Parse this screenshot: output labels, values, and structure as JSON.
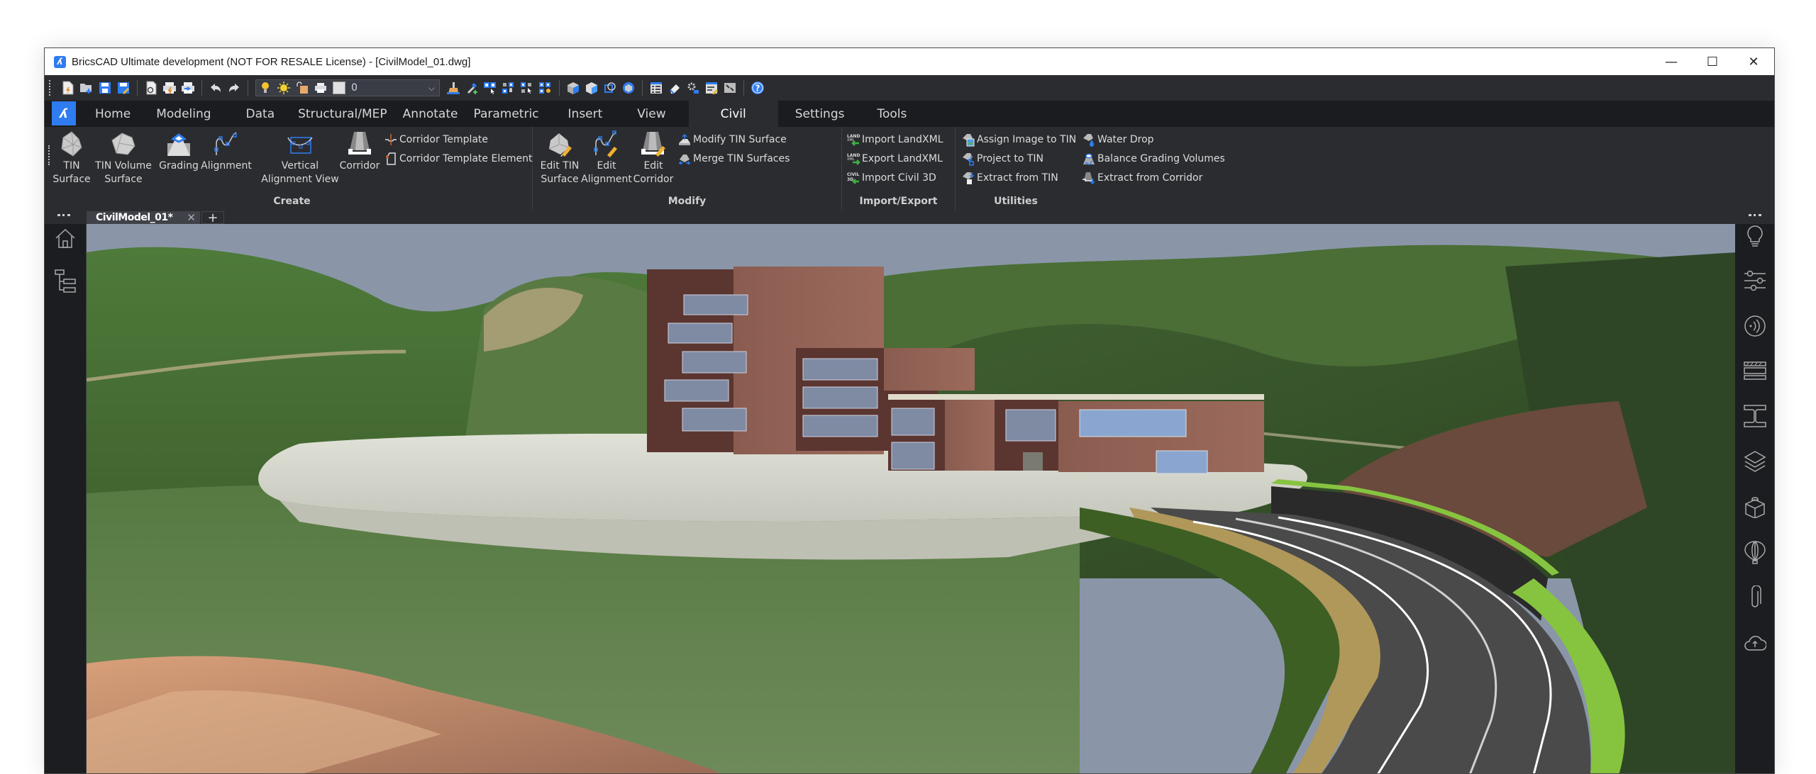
{
  "window": {
    "title": "BricsCAD Ultimate development (NOT FOR RESALE License) - [CivilModel_01.dwg]",
    "controls": {
      "minimize": "—",
      "maximize": "☐",
      "close": "✕"
    }
  },
  "quick_access": {
    "icons": [
      "new-icon",
      "open-icon",
      "save-icon",
      "save-as-icon",
      "print-preview-icon",
      "plot-icon",
      "batch-plot-icon",
      "undo-icon",
      "redo-icon",
      "layer-on-icon",
      "layer-freeze-icon",
      "layer-lock-icon",
      "layer-plot-icon"
    ],
    "layer_value": "0",
    "tool_icons": [
      "match-properties-icon",
      "pick-add-icon",
      "select-icon",
      "isolate-icon",
      "select-similar-icon",
      "hide-icon",
      "solid-box-icon",
      "solid-blue-icon",
      "region-icon",
      "view-cube-icon",
      "properties-icon",
      "eraser-icon",
      "settings-icon",
      "edit-icon",
      "window-icon",
      "help-icon"
    ]
  },
  "ribbon": {
    "tabs": [
      "Home",
      "Modeling",
      "Data",
      "Structural/MEP",
      "Annotate",
      "Parametric",
      "Insert",
      "View",
      "Civil",
      "Settings",
      "Tools"
    ],
    "active_tab": "Civil",
    "panels": {
      "create": {
        "title": "Create",
        "big_buttons": [
          {
            "label1": "TIN",
            "label2": "Surface",
            "icon": "tin-surface-icon"
          },
          {
            "label1": "TIN Volume",
            "label2": "Surface",
            "icon": "tin-volume-surface-icon"
          },
          {
            "label1": "Grading",
            "label2": "",
            "icon": "grading-icon"
          },
          {
            "label1": "Alignment",
            "label2": "",
            "icon": "alignment-icon"
          },
          {
            "label1": "Vertical",
            "label2": "Alignment View",
            "icon": "vertical-alignment-view-icon"
          },
          {
            "label1": "Corridor",
            "label2": "",
            "icon": "corridor-icon"
          }
        ],
        "small_buttons": [
          {
            "label": "Corridor Template",
            "icon": "corridor-template-icon"
          },
          {
            "label": "Corridor Template Element",
            "icon": "corridor-template-element-icon"
          }
        ]
      },
      "modify": {
        "title": "Modify",
        "big_buttons": [
          {
            "label1": "Edit TIN",
            "label2": "Surface",
            "icon": "edit-tin-surface-icon"
          },
          {
            "label1": "Edit",
            "label2": "Alignment",
            "icon": "edit-alignment-icon"
          },
          {
            "label1": "Edit",
            "label2": "Corridor",
            "icon": "edit-corridor-icon"
          }
        ],
        "small_buttons": [
          {
            "label": "Modify TIN Surface",
            "icon": "modify-tin-surface-icon"
          },
          {
            "label": "Merge TIN Surfaces",
            "icon": "merge-tin-surfaces-icon"
          }
        ]
      },
      "import_export": {
        "title": "Import/Export",
        "small_buttons": [
          {
            "label": "Import LandXML",
            "icon": "import-landxml-icon"
          },
          {
            "label": "Export LandXML",
            "icon": "export-landxml-icon"
          },
          {
            "label": "Import Civil 3D",
            "icon": "import-civil3d-icon"
          }
        ]
      },
      "utilities": {
        "title": "Utilities",
        "small_buttons": [
          {
            "label": "Assign Image to TIN",
            "icon": "assign-image-icon"
          },
          {
            "label": "Project to TIN",
            "icon": "project-to-tin-icon"
          },
          {
            "label": "Extract from TIN",
            "icon": "extract-from-tin-icon"
          },
          {
            "label": "Water Drop",
            "icon": "water-drop-icon"
          },
          {
            "label": "Balance Grading Volumes",
            "icon": "balance-grading-icon"
          },
          {
            "label": "Extract from Corridor",
            "icon": "extract-from-corridor-icon"
          }
        ]
      }
    }
  },
  "document_tabs": {
    "tabs": [
      {
        "label": "CivilModel_01*"
      }
    ],
    "add_label": "+",
    "close_label": "✕"
  },
  "left_sidebar": {
    "icons": [
      "home-icon",
      "structure-tree-icon"
    ]
  },
  "right_sidebar": {
    "icons": [
      "tips-lightbulb-icon",
      "properties-sliders-icon",
      "sound-signal-icon",
      "layers-stack-table-icon",
      "i-beam-icon",
      "layers-icon",
      "component-block-icon",
      "balloon-icon",
      "attachment-paperclip-icon",
      "cloud-upload-icon"
    ]
  },
  "viewport": {
    "description": "3D civil model rendering: terrain, brick buildings on a platform, curved road with retaining wall",
    "colors": {
      "sky": "#8a96a8",
      "grass": "#4f7338",
      "brick": "#8a5a4e",
      "road": "#4a4a4a",
      "platform": "#d8d9cf",
      "bright_grass": "#86c440"
    }
  }
}
